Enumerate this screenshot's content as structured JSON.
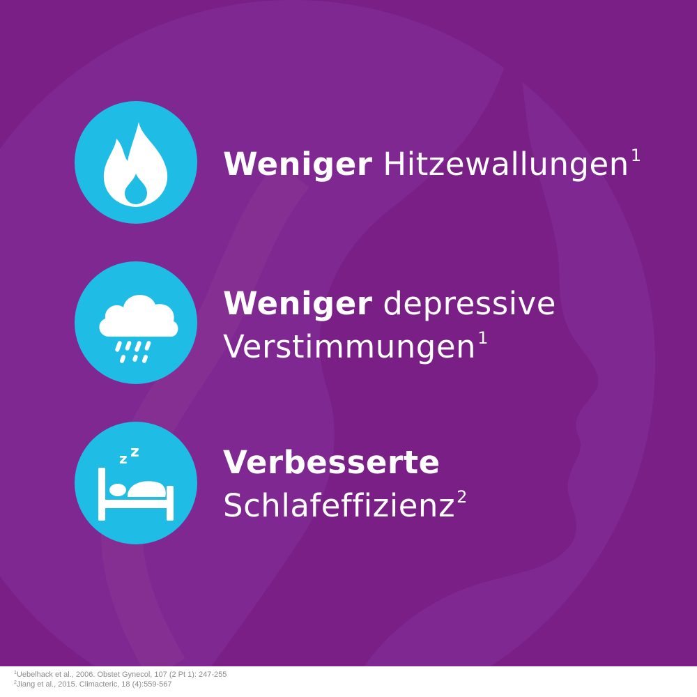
{
  "colors": {
    "background": "#7a1f86",
    "silhouette": "#8b3596",
    "icon_circle": "#1fbde6",
    "text": "#ffffff",
    "footer_background": "#ffffff",
    "footer_text": "#8a8a8a"
  },
  "benefits": [
    {
      "icon": "flame-icon",
      "bold": "Weniger",
      "line1_rest": " Hitzewallungen",
      "line2": "",
      "superscript": "1"
    },
    {
      "icon": "rain-cloud-icon",
      "bold": "Weniger",
      "line1_rest": " depressive",
      "line2": "Verstimmungen",
      "superscript": "1"
    },
    {
      "icon": "sleeping-bed-icon",
      "bold": "Verbesserte",
      "line1_rest": "",
      "line2": "Schlafeffizienz",
      "superscript": "2"
    }
  ],
  "references": [
    {
      "number": "1",
      "text": "Uebelhack et al., 2006. Obstet Gynecol, 107 (2 Pt 1): 247-255"
    },
    {
      "number": "2",
      "text": "Jiang et al., 2015. Climacteric, 18 (4):559-567"
    }
  ]
}
